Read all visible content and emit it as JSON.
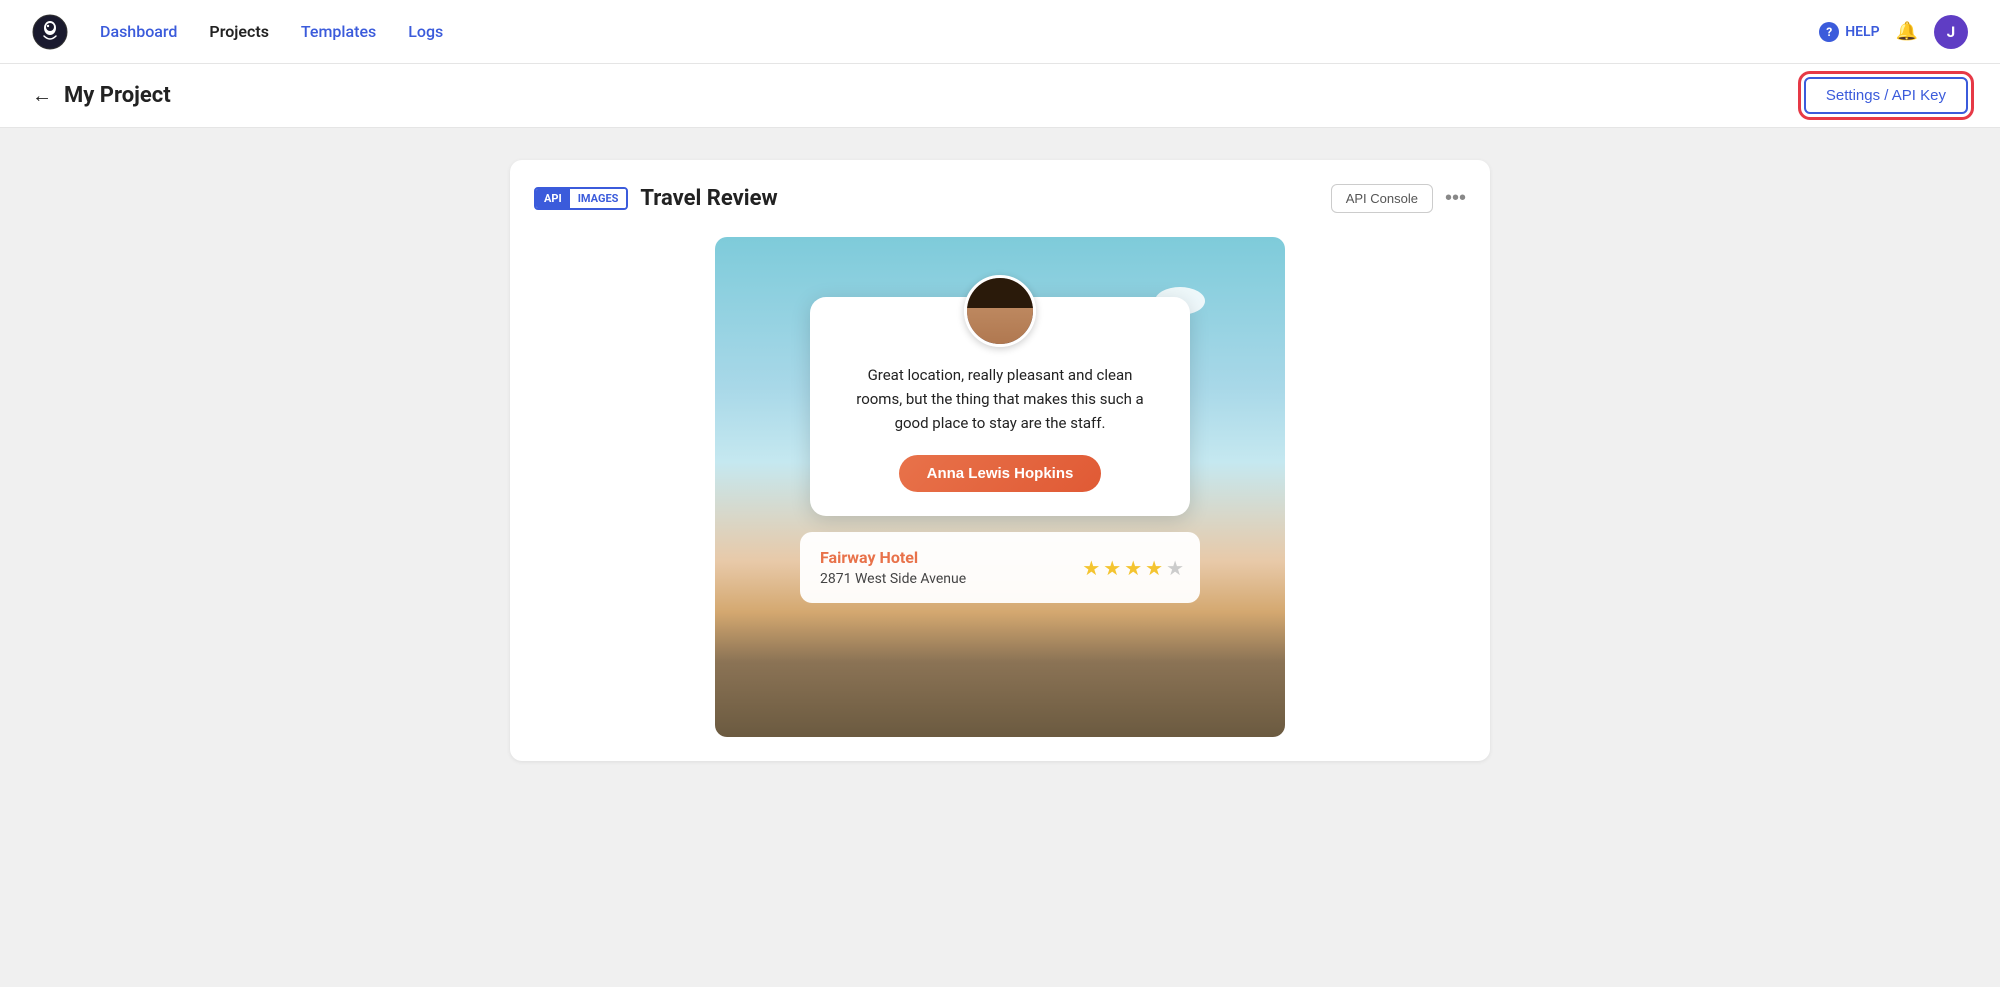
{
  "navbar": {
    "logo_alt": "Bannerbear logo",
    "nav_items": [
      {
        "label": "Dashboard",
        "href": "#",
        "active": false
      },
      {
        "label": "Projects",
        "href": "#",
        "active": true
      },
      {
        "label": "Templates",
        "href": "#",
        "active": false
      },
      {
        "label": "Logs",
        "href": "#",
        "active": false
      }
    ],
    "help_label": "HELP",
    "user_initial": "J"
  },
  "page_header": {
    "back_label": "← My Project",
    "settings_button_label": "Settings / API Key"
  },
  "project_card": {
    "badge_api": "API",
    "badge_images": "IMAGES",
    "title": "Travel Review",
    "api_console_label": "API Console",
    "more_label": "•••"
  },
  "review": {
    "review_text": "Great location, really pleasant and clean rooms, but the thing that makes this such a good place to stay are the staff.",
    "reviewer_name": "Anna Lewis Hopkins",
    "hotel_name": "Fairway Hotel",
    "hotel_address": "2871 West Side Avenue",
    "stars_filled": 4,
    "stars_total": 5
  },
  "colors": {
    "brand_blue": "#3b5bdb",
    "accent_orange": "#e8724a",
    "star_gold": "#f4c430",
    "settings_outline": "#e63946"
  }
}
